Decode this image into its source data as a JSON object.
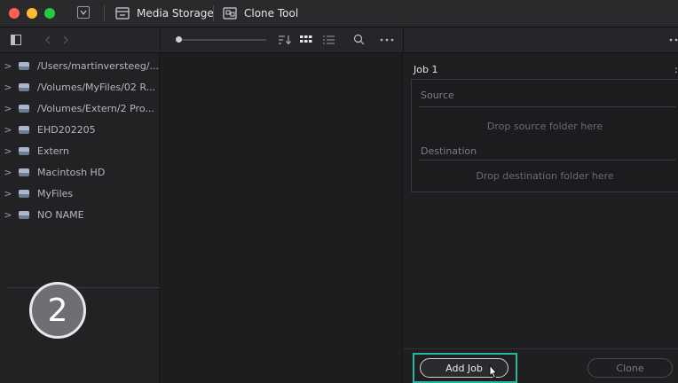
{
  "window": {
    "controls": {
      "close_color": "#ff5f57",
      "minimize_color": "#febc2e",
      "zoom_color": "#28c840"
    }
  },
  "tabs": [
    {
      "label": "Media Storage",
      "icon": "drive-icon"
    },
    {
      "label": "Clone Tool",
      "icon": "clone-icon"
    }
  ],
  "storage": {
    "items": [
      {
        "label": "/Users/martinversteeg/..."
      },
      {
        "label": "/Volumes/MyFiles/02 R..."
      },
      {
        "label": "/Volumes/Extern/2 Pro..."
      },
      {
        "label": "EHD202205"
      },
      {
        "label": "Extern"
      },
      {
        "label": "Macintosh HD"
      },
      {
        "label": "MyFiles"
      },
      {
        "label": "NO NAME"
      }
    ]
  },
  "badge": {
    "value": "2"
  },
  "job": {
    "title": "Job 1",
    "source_label": "Source",
    "source_drop": "Drop source folder here",
    "destination_label": "Destination",
    "destination_drop": "Drop destination folder here"
  },
  "buttons": {
    "add_job": "Add Job",
    "clone": "Clone"
  },
  "colors": {
    "highlight": "#27b5a0",
    "background": "#1b1b1e"
  }
}
